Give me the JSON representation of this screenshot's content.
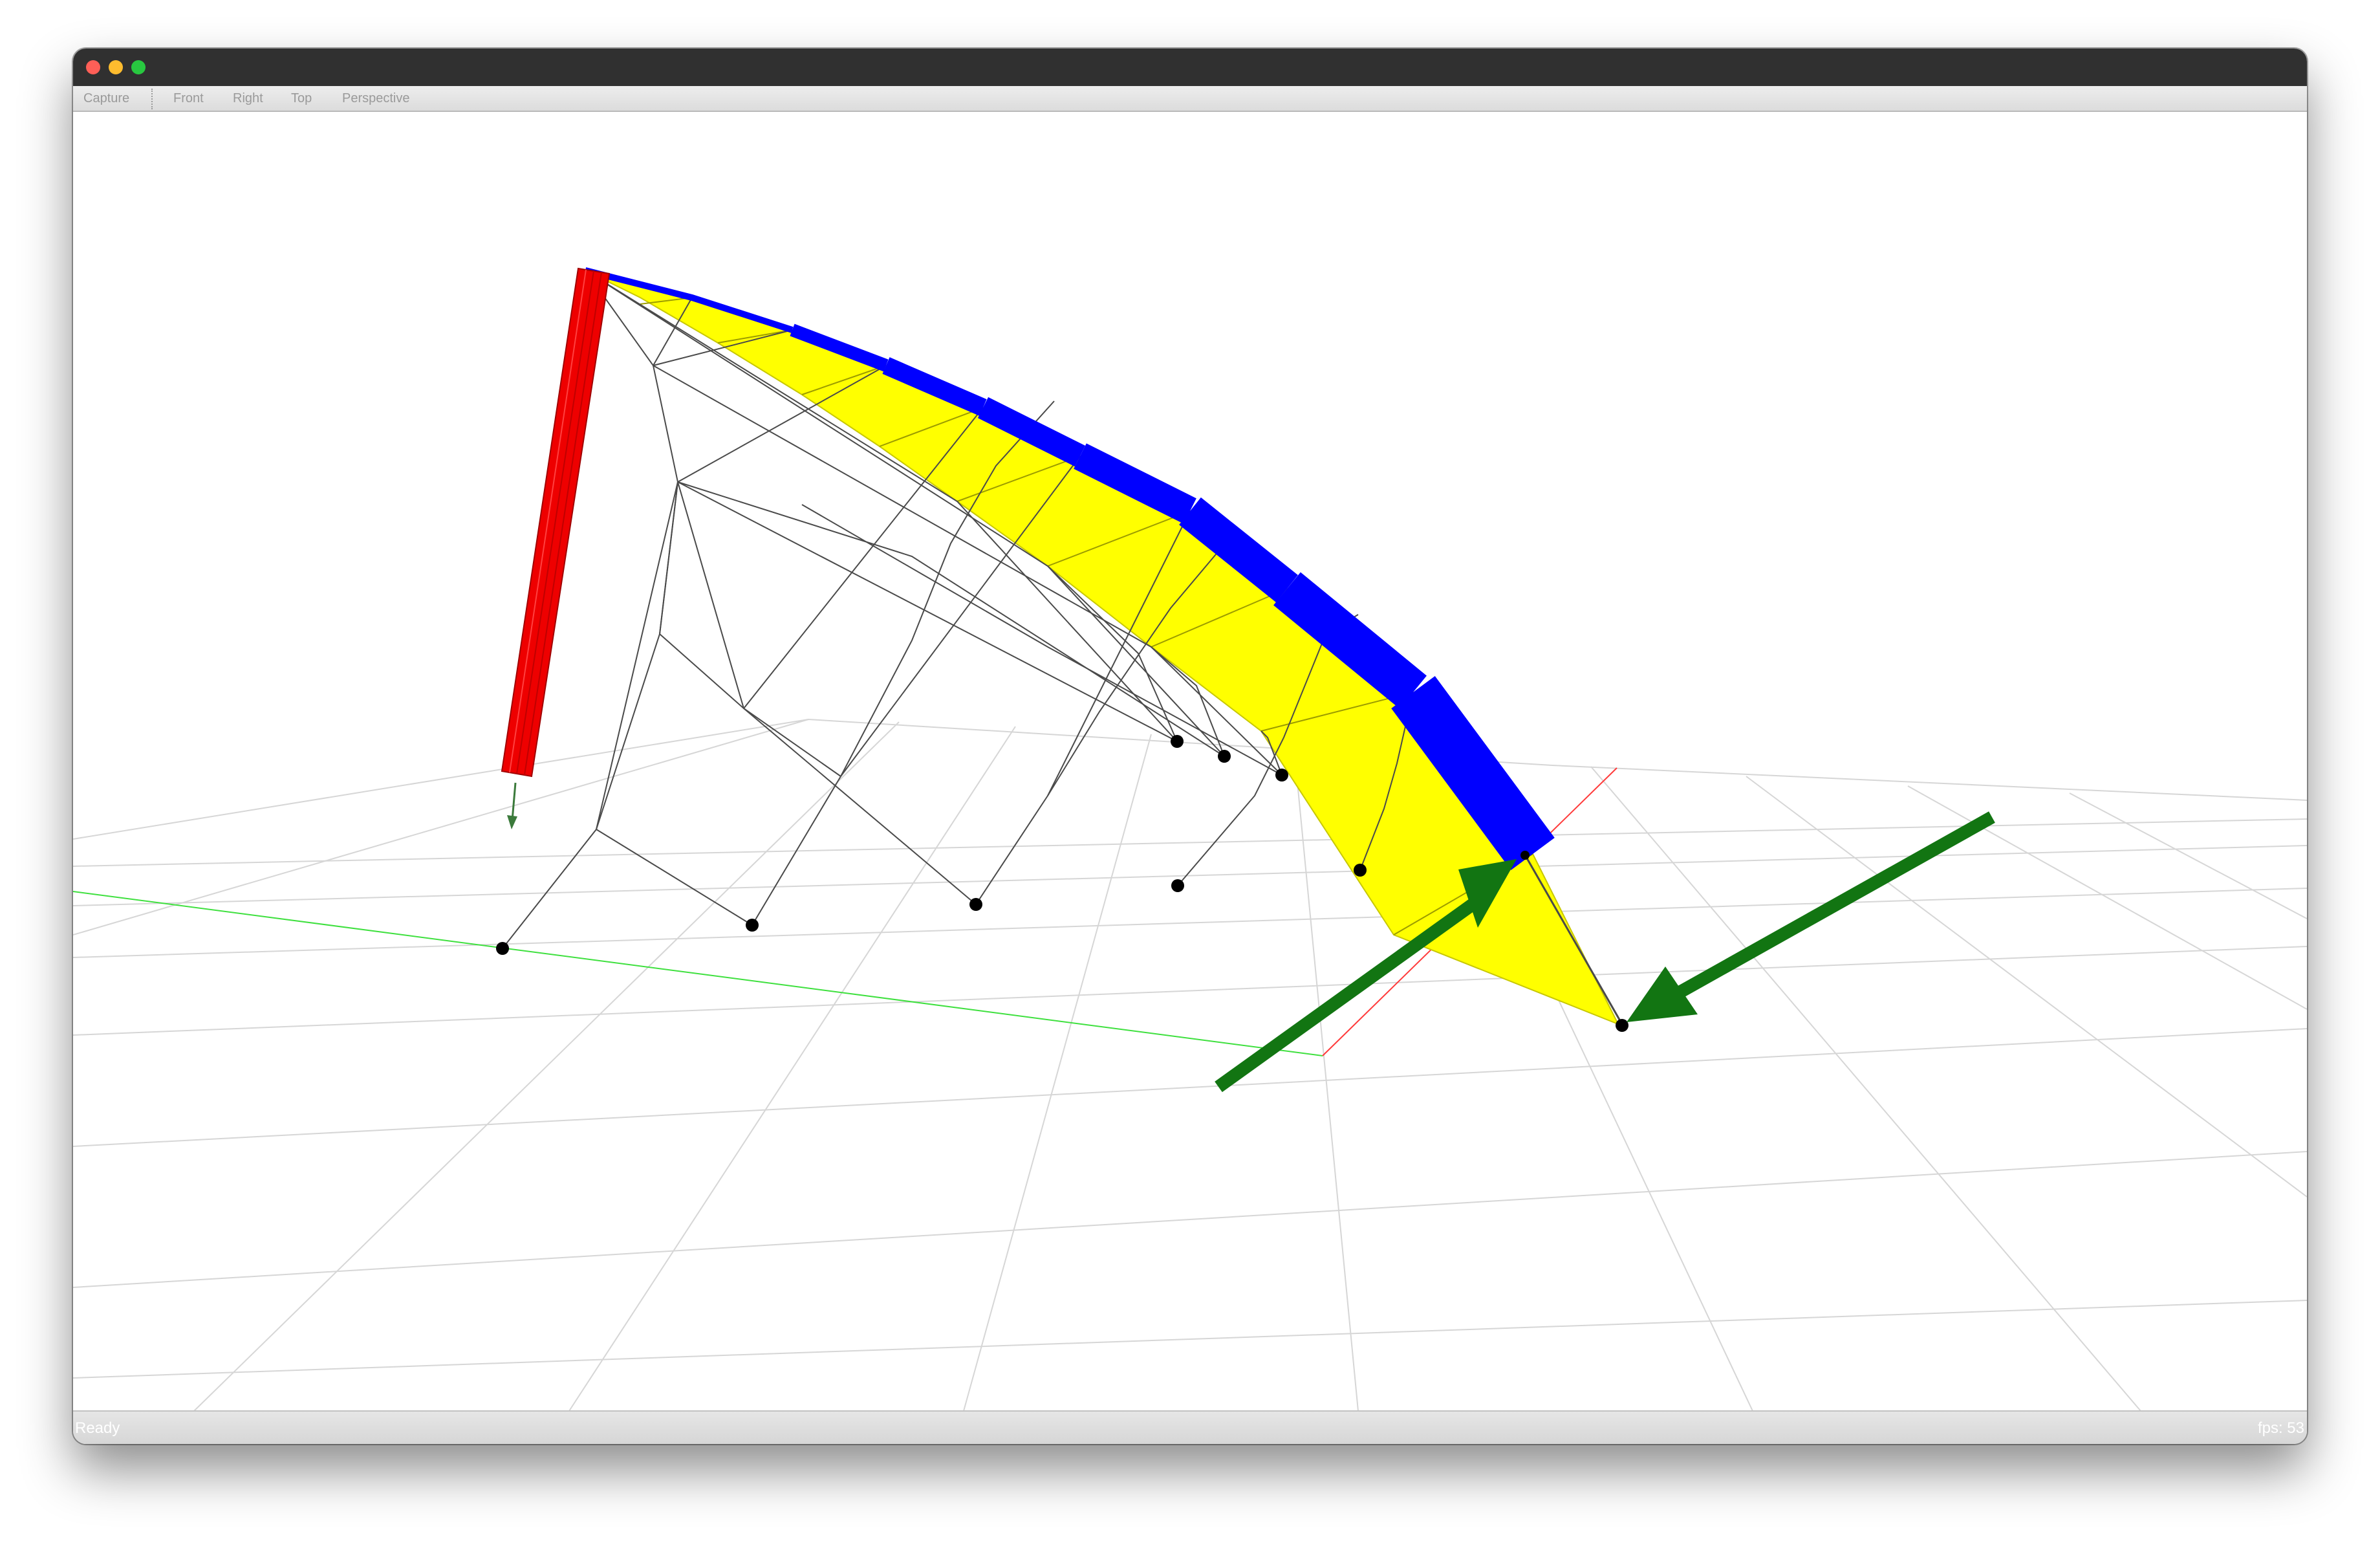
{
  "toolbar": {
    "capture_label": "Capture",
    "views": [
      {
        "label": "Front"
      },
      {
        "label": "Right"
      },
      {
        "label": "Top"
      },
      {
        "label": "Perspective"
      }
    ]
  },
  "status": {
    "left": "Ready",
    "right": "fps: 53"
  },
  "colors": {
    "canopy": "#ffff00",
    "leading_edge": "#0000ff",
    "pilot_tube": "#ee0000",
    "force_arrows": "#127512",
    "grid": "#d4d4d4",
    "x_axis": "#ff2a2a",
    "y_axis": "#2adb2a"
  }
}
